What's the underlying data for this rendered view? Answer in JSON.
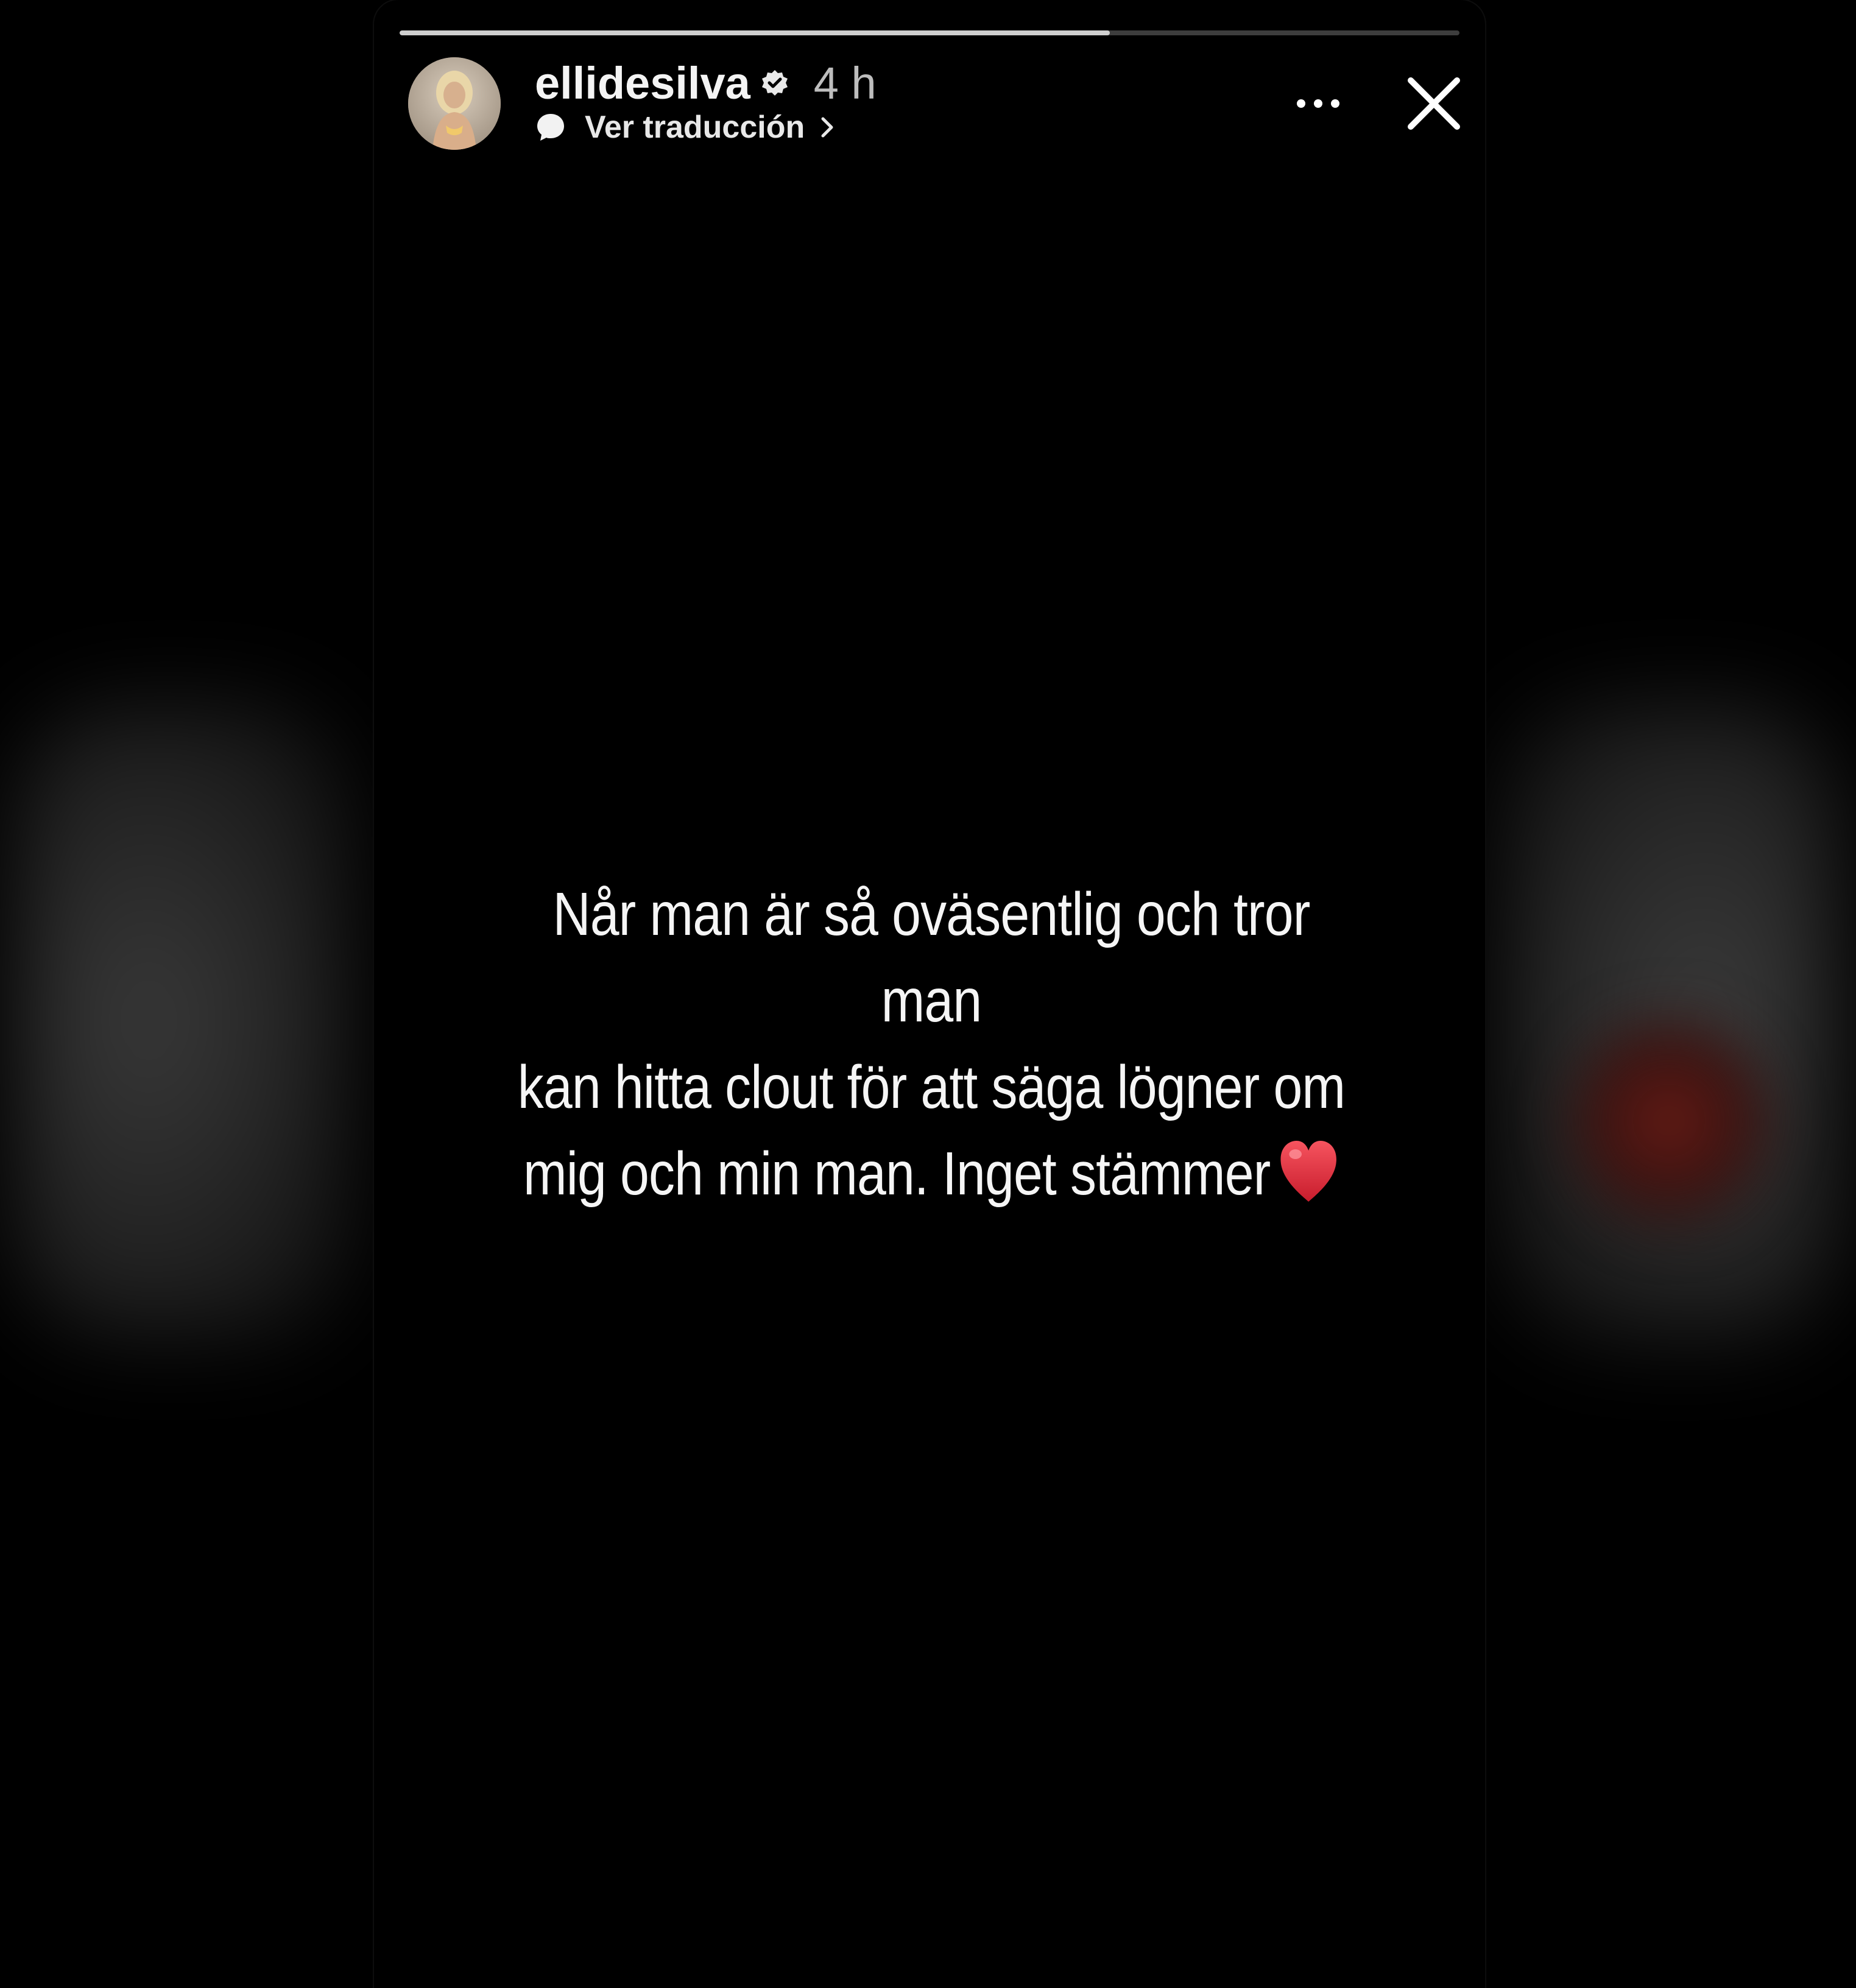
{
  "story": {
    "progress": 0.67,
    "username": "ellidesilva",
    "time_ago": "4 h",
    "translate_label": "Ver traducción",
    "text_lines": [
      "Når man är så oväsentlig och tror man",
      "kan hitta clout för att säga lögner om",
      "mig och min man. Inget stämmer"
    ],
    "emoji": "heart-emoji"
  },
  "icons": {
    "verified": "verified-badge-icon",
    "translate": "speech-bubble-icon",
    "chevron": "chevron-right-icon",
    "more": "more-dots-icon",
    "close": "close-icon"
  },
  "colors": {
    "background": "#000000",
    "text": "#f5f5f5",
    "heart": "#e0283a",
    "progress_fill": "#cfcfcf",
    "progress_track": "#3d3d3d"
  }
}
